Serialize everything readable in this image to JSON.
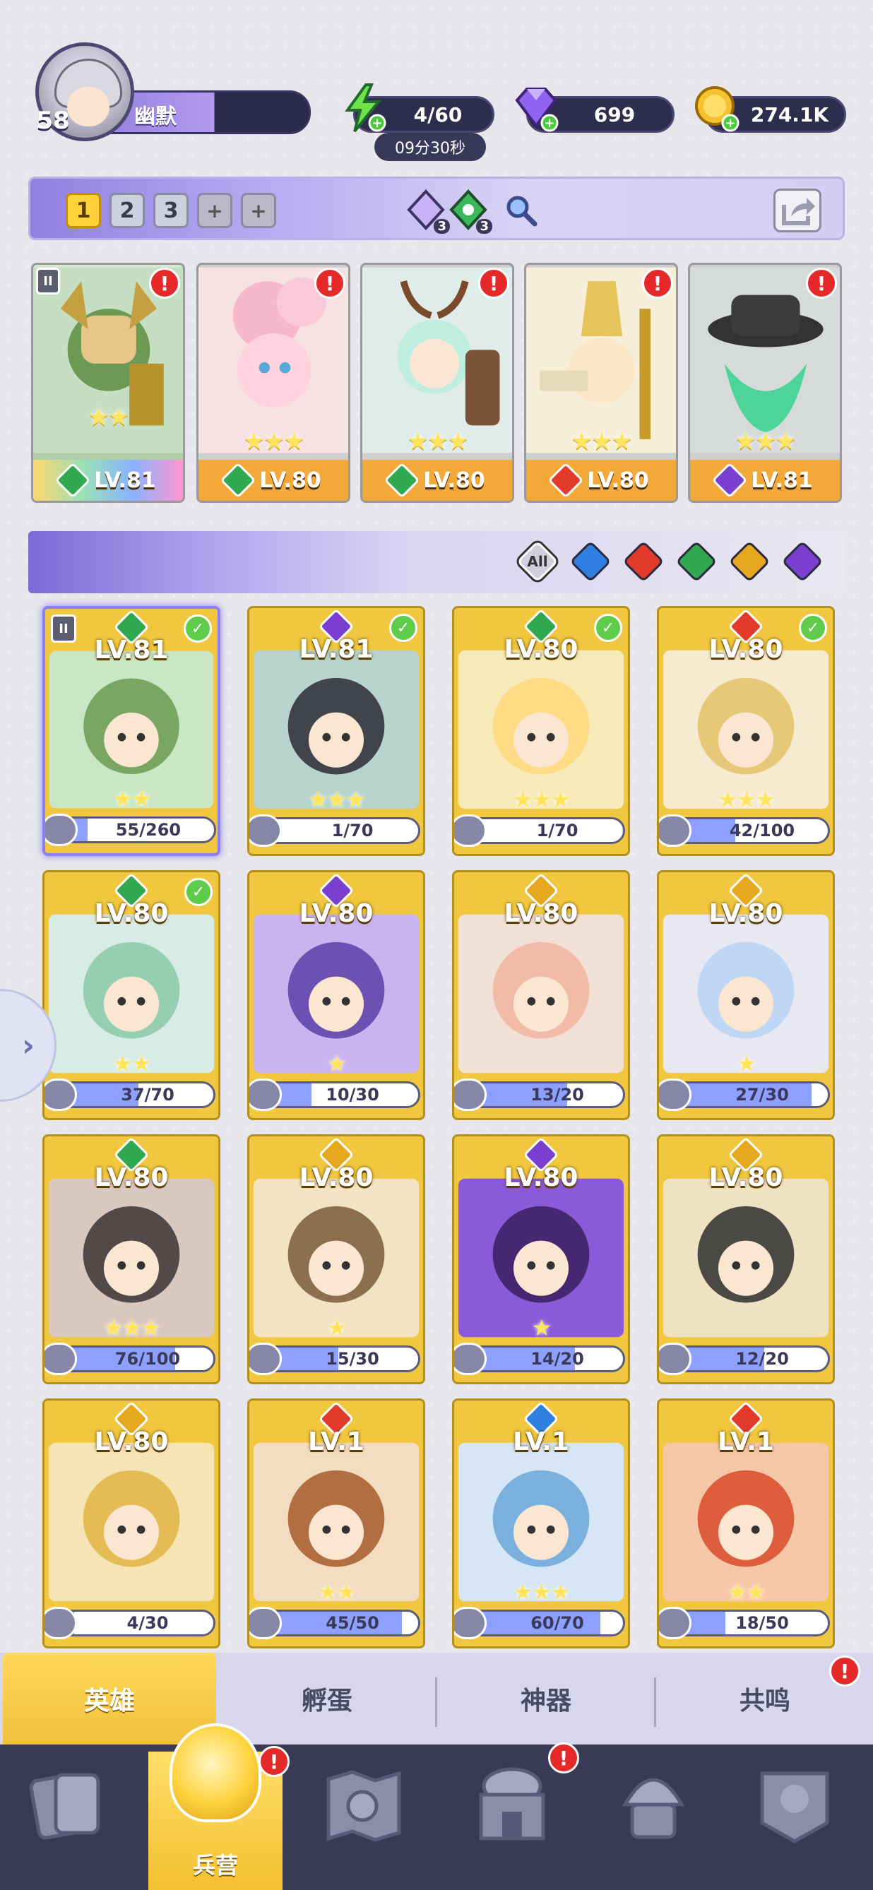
{
  "player": {
    "level": "58",
    "name": "幽默"
  },
  "resources": {
    "energy": "4/60",
    "energy_timer": "09分30秒",
    "gems": "699",
    "gold": "274.1K"
  },
  "team_bar": {
    "slots": [
      "1",
      "2",
      "3"
    ],
    "element_counts": [
      "3",
      "3"
    ]
  },
  "team_heroes": [
    {
      "level": "LV.81",
      "stars": "★★",
      "element": "#2fa84f"
    },
    {
      "level": "LV.80",
      "stars": "★★★",
      "element": "#2fa84f"
    },
    {
      "level": "LV.80",
      "stars": "★★★",
      "element": "#2fa84f"
    },
    {
      "level": "LV.80",
      "stars": "★★★",
      "element": "#e23b2b"
    },
    {
      "level": "LV.81",
      "stars": "★★★",
      "element": "#7b3fd0"
    }
  ],
  "filter": {
    "all_label": "All"
  },
  "heroes": [
    {
      "level": "LV.81",
      "progress": "55/260",
      "fill": 0.21,
      "stars": "★★",
      "element": "#2fa84f"
    },
    {
      "level": "LV.81",
      "progress": "1/70",
      "fill": 0.01,
      "stars": "★★★",
      "element": "#7b3fd0"
    },
    {
      "level": "LV.80",
      "progress": "1/70",
      "fill": 0.01,
      "stars": "★★★",
      "element": "#2fa84f"
    },
    {
      "level": "LV.80",
      "progress": "42/100",
      "fill": 0.42,
      "stars": "★★★",
      "element": "#e23b2b"
    },
    {
      "level": "LV.80",
      "progress": "37/70",
      "fill": 0.53,
      "stars": "★★",
      "element": "#2fa84f"
    },
    {
      "level": "LV.80",
      "progress": "10/30",
      "fill": 0.33,
      "stars": "★",
      "element": "#7b3fd0"
    },
    {
      "level": "LV.80",
      "progress": "13/20",
      "fill": 0.65,
      "stars": "",
      "element": "#e5a81e"
    },
    {
      "level": "LV.80",
      "progress": "27/30",
      "fill": 0.9,
      "stars": "★",
      "element": "#e5a81e"
    },
    {
      "level": "LV.80",
      "progress": "76/100",
      "fill": 0.76,
      "stars": "★★★",
      "element": "#2fa84f"
    },
    {
      "level": "LV.80",
      "progress": "15/30",
      "fill": 0.5,
      "stars": "★",
      "element": "#e5a81e"
    },
    {
      "level": "LV.80",
      "progress": "14/20",
      "fill": 0.7,
      "stars": "★",
      "element": "#7b3fd0"
    },
    {
      "level": "LV.80",
      "progress": "12/20",
      "fill": 0.6,
      "stars": "",
      "element": "#e5a81e"
    },
    {
      "level": "LV.80",
      "progress": "4/30",
      "fill": 0.13,
      "stars": "",
      "element": "#e5a81e"
    },
    {
      "level": "LV.1",
      "progress": "45/50",
      "fill": 0.9,
      "stars": "★★",
      "element": "#e23b2b"
    },
    {
      "level": "LV.1",
      "progress": "60/70",
      "fill": 0.86,
      "stars": "★★★",
      "element": "#2f7fe0"
    },
    {
      "level": "LV.1",
      "progress": "18/50",
      "fill": 0.36,
      "stars": "★★",
      "element": "#e23b2b"
    }
  ],
  "sub_tabs": [
    "英雄",
    "孵蛋",
    "神器",
    "共鸣"
  ],
  "nav": {
    "barracks_label": "兵营"
  }
}
